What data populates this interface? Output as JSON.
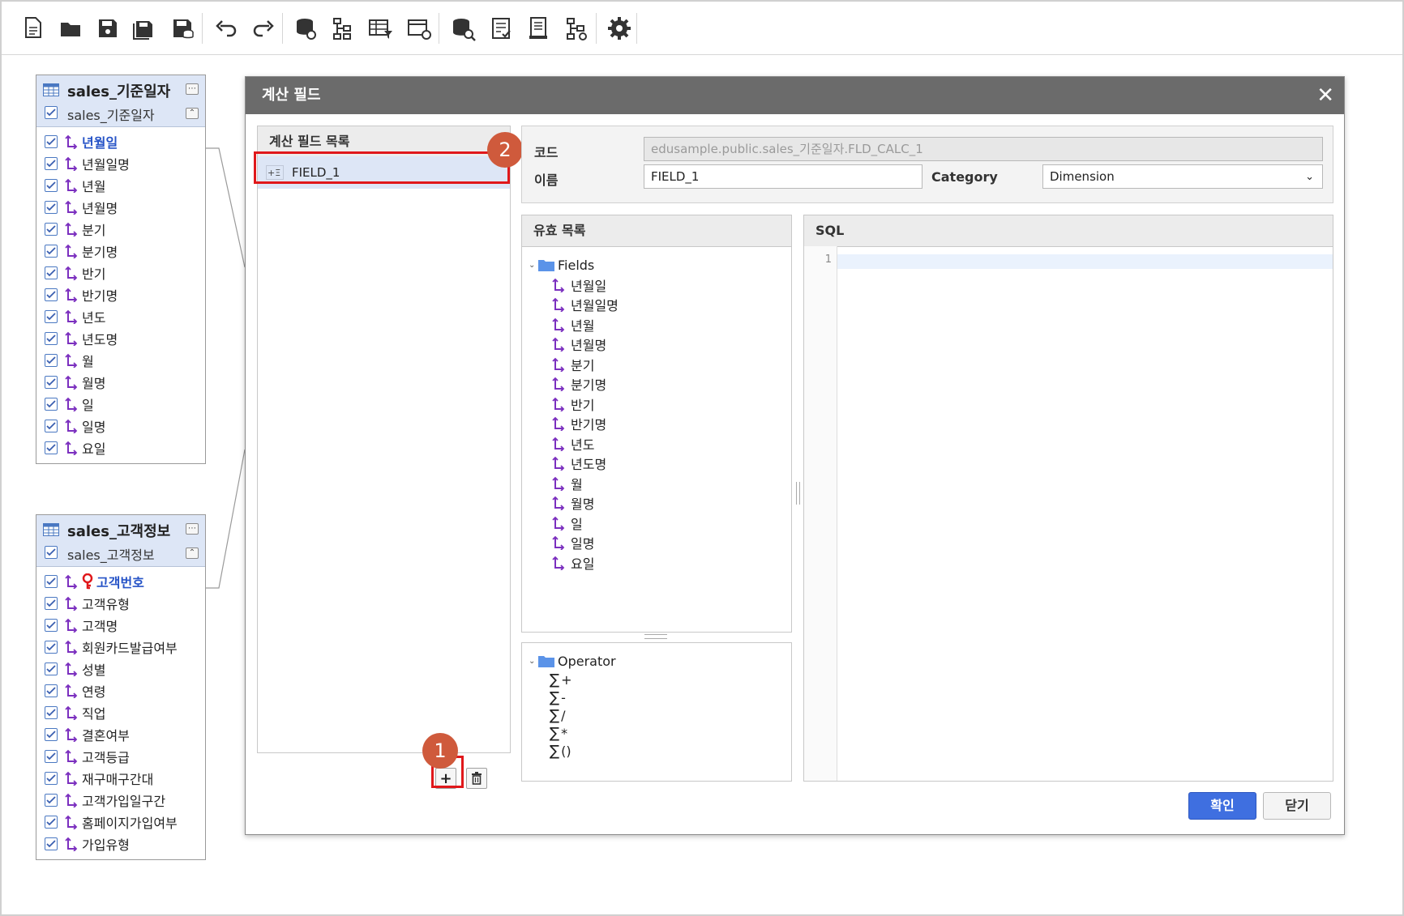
{
  "toolbar": {
    "items": [
      {
        "name": "new-document-icon"
      },
      {
        "name": "open-folder-icon"
      },
      {
        "name": "save-icon"
      },
      {
        "name": "save-as-icon"
      },
      {
        "name": "save-db-icon"
      },
      {
        "name": "undo-icon"
      },
      {
        "name": "redo-icon"
      },
      {
        "name": "datasource-link-icon"
      },
      {
        "name": "hierarchy-icon"
      },
      {
        "name": "table-filter-icon"
      },
      {
        "name": "table-settings-icon"
      },
      {
        "name": "db-search-icon"
      },
      {
        "name": "checklist-icon"
      },
      {
        "name": "document-icon"
      },
      {
        "name": "hierarchy-settings-icon"
      },
      {
        "name": "gear-icon"
      }
    ]
  },
  "tables": [
    {
      "title": "sales_기준일자",
      "subtitle": "sales_기준일자",
      "rows": [
        {
          "label": "년월일",
          "key": true,
          "pk": false
        },
        {
          "label": "년월일명"
        },
        {
          "label": "년월"
        },
        {
          "label": "년월명"
        },
        {
          "label": "분기"
        },
        {
          "label": "분기명"
        },
        {
          "label": "반기"
        },
        {
          "label": "반기명"
        },
        {
          "label": "년도"
        },
        {
          "label": "년도명"
        },
        {
          "label": "월"
        },
        {
          "label": "월명"
        },
        {
          "label": "일"
        },
        {
          "label": "일명"
        },
        {
          "label": "요일"
        }
      ]
    },
    {
      "title": "sales_고객정보",
      "subtitle": "sales_고객정보",
      "rows": [
        {
          "label": "고객번호",
          "key": true,
          "pk": true
        },
        {
          "label": "고객유형"
        },
        {
          "label": "고객명"
        },
        {
          "label": "회원카드발급여부"
        },
        {
          "label": "성별"
        },
        {
          "label": "연령"
        },
        {
          "label": "직업"
        },
        {
          "label": "결혼여부"
        },
        {
          "label": "고객등급"
        },
        {
          "label": "재구매구간대"
        },
        {
          "label": "고객가입일구간"
        },
        {
          "label": "홈페이지가입여부"
        },
        {
          "label": "가입유형"
        }
      ]
    }
  ],
  "dialog": {
    "title": "계산 필드",
    "close_label": "✕",
    "field_list": {
      "header": "계산 필드 목록",
      "items": [
        {
          "label": "FIELD_1"
        }
      ],
      "add_label": "+",
      "badge_add": "1",
      "badge_item": "2"
    },
    "form": {
      "code_label": "코드",
      "code_value": "edusample.public.sales_기준일자.FLD_CALC_1",
      "name_label": "이름",
      "name_value": "FIELD_1",
      "category_label": "Category",
      "category_value": "Dimension"
    },
    "valid_list": {
      "header": "유효 목록",
      "fields_folder": "Fields",
      "fields": [
        "년월일",
        "년월일명",
        "년월",
        "년월명",
        "분기",
        "분기명",
        "반기",
        "반기명",
        "년도",
        "년도명",
        "월",
        "월명",
        "일",
        "일명",
        "요일"
      ]
    },
    "operators": {
      "folder": "Operator",
      "items": [
        "+",
        "-",
        "/",
        "*",
        "()"
      ]
    },
    "sql": {
      "header": "SQL",
      "line_number": "1"
    },
    "buttons": {
      "ok": "확인",
      "close": "닫기"
    }
  },
  "colors": {
    "accent": "#3f6fe0",
    "badge": "#cf5a3c",
    "highlight": "#e0181b",
    "dimension_icon": "#7b2fbf"
  }
}
